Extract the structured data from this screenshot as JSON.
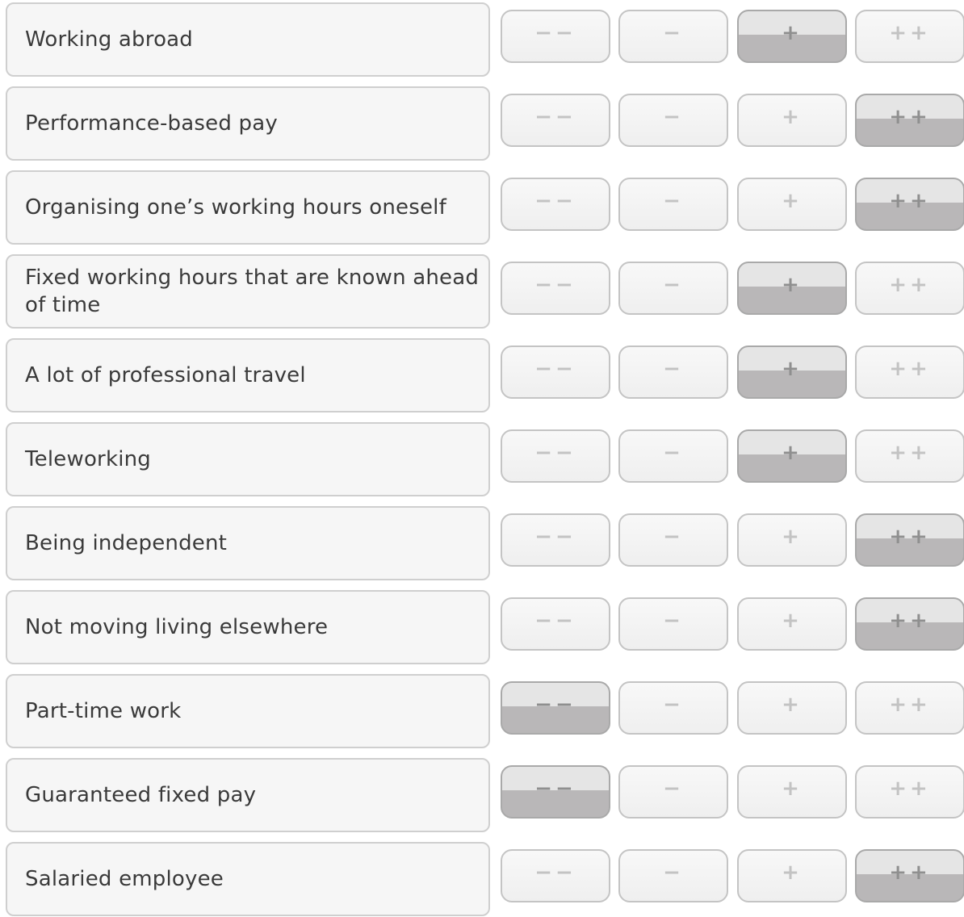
{
  "options": [
    "−−",
    "−",
    "+",
    "++"
  ],
  "items": [
    {
      "label": "Working abroad",
      "selected": 2
    },
    {
      "label": "Performance-based pay",
      "selected": 3
    },
    {
      "label": "Organising one’s working hours oneself",
      "selected": 3
    },
    {
      "label": "Fixed working hours that are known ahead of time",
      "selected": 2
    },
    {
      "label": "A lot of professional travel",
      "selected": 2
    },
    {
      "label": "Teleworking",
      "selected": 2
    },
    {
      "label": "Being independent",
      "selected": 3
    },
    {
      "label": "Not moving living elsewhere",
      "selected": 3
    },
    {
      "label": "Part-time work",
      "selected": 0
    },
    {
      "label": "Guaranteed fixed pay",
      "selected": 0
    },
    {
      "label": "Salaried employee",
      "selected": 3
    }
  ]
}
